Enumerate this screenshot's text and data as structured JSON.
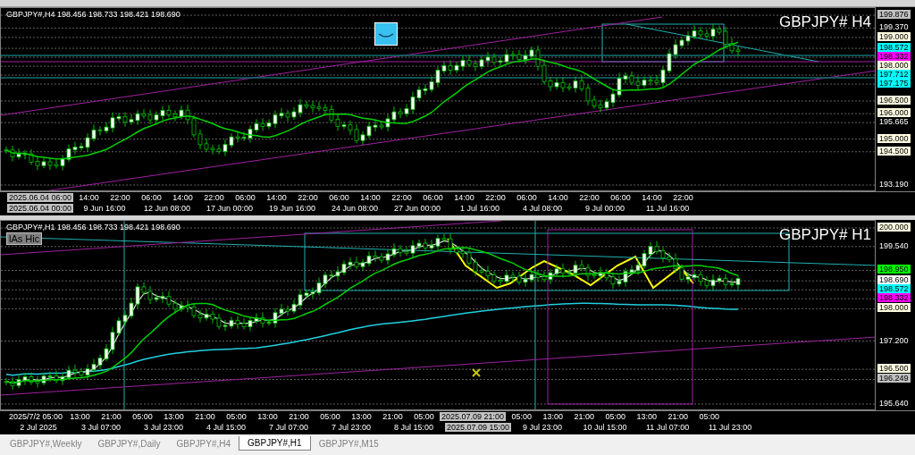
{
  "panels": [
    {
      "header": "GBPJPY#,H4 198.456 198.733 198.421 198.690",
      "title": "GBPJPY#  H4",
      "marker_button": true,
      "price_labels": [
        {
          "text": "199.876",
          "kind": "tag",
          "color": "#c0c0c0"
        },
        {
          "text": "199.370",
          "kind": "plain"
        },
        {
          "text": "199.000",
          "kind": "tag",
          "color": "#fffbe0"
        },
        {
          "text": "198.572",
          "kind": "tag",
          "color": "#00ffff"
        },
        {
          "text": "198.332",
          "kind": "tag",
          "color": "#ff00ff"
        },
        {
          "text": "198.000",
          "kind": "tag",
          "color": "#fffbe0"
        },
        {
          "text": "197.712",
          "kind": "tag",
          "color": "#00ffff"
        },
        {
          "text": "197.175",
          "kind": "tag",
          "color": "#00ffff"
        },
        {
          "text": "196.500",
          "kind": "tag",
          "color": "#fffbe0"
        },
        {
          "text": "196.000",
          "kind": "tag",
          "color": "#fffbe0"
        },
        {
          "text": "195.665",
          "kind": "plain"
        },
        {
          "text": "195.000",
          "kind": "tag",
          "color": "#fffbe0"
        },
        {
          "text": "194.500",
          "kind": "tag",
          "color": "#fffbe0"
        },
        {
          "text": "193.190",
          "kind": "plain"
        }
      ],
      "time_top": [
        {
          "text": "2025.06.04 06:00",
          "kind": "cursor"
        },
        {
          "text": "14:00",
          "kind": "tick"
        },
        {
          "text": "22:00",
          "kind": "tick"
        },
        {
          "text": "06:00",
          "kind": "tick"
        },
        {
          "text": "14:00",
          "kind": "tick"
        },
        {
          "text": "22:00",
          "kind": "tick"
        },
        {
          "text": "06:00",
          "kind": "tick"
        },
        {
          "text": "14:00",
          "kind": "tick"
        },
        {
          "text": "22:00",
          "kind": "tick"
        },
        {
          "text": "06:00",
          "kind": "tick"
        },
        {
          "text": "14:00",
          "kind": "tick"
        },
        {
          "text": "22:00",
          "kind": "tick"
        },
        {
          "text": "06:00",
          "kind": "tick"
        },
        {
          "text": "14:00",
          "kind": "tick"
        },
        {
          "text": "22:00",
          "kind": "tick"
        },
        {
          "text": "06:00",
          "kind": "tick"
        },
        {
          "text": "14:00",
          "kind": "tick"
        },
        {
          "text": "22:00",
          "kind": "tick"
        },
        {
          "text": "06:00",
          "kind": "tick"
        },
        {
          "text": "14:00",
          "kind": "tick"
        },
        {
          "text": "22:00",
          "kind": "tick"
        }
      ],
      "time_bottom": [
        {
          "text": "2025.06.04 00:00",
          "kind": "cursor"
        },
        {
          "text": "9 Jun 16:00",
          "kind": "tick"
        },
        {
          "text": "12 Jun 08:00",
          "kind": "tick"
        },
        {
          "text": "17 Jun 00:00",
          "kind": "tick"
        },
        {
          "text": "19 Jun 16:00",
          "kind": "tick"
        },
        {
          "text": "24 Jun 08:00",
          "kind": "tick"
        },
        {
          "text": "27 Jun 00:00",
          "kind": "tick"
        },
        {
          "text": "1 Jul 16:00",
          "kind": "tick"
        },
        {
          "text": "4 Jul 08:00",
          "kind": "tick"
        },
        {
          "text": "9 Jul 00:00",
          "kind": "tick"
        },
        {
          "text": "11 Jul 16:00",
          "kind": "tick"
        }
      ]
    },
    {
      "header": "GBPJPY#,H1 198.456 198.733 198.421 198.690",
      "title": "GBPJPY#  H1",
      "button_label": "lAs Hic",
      "price_labels": [
        {
          "text": "200.000",
          "kind": "tag",
          "color": "#fffbe0"
        },
        {
          "text": "199.540",
          "kind": "plain"
        },
        {
          "text": "198.950",
          "kind": "tag",
          "color": "#00ff00"
        },
        {
          "text": "198.690",
          "kind": "tag",
          "color": "#ffffff"
        },
        {
          "text": "198.572",
          "kind": "tag",
          "color": "#00ffff"
        },
        {
          "text": "198.332",
          "kind": "tag",
          "color": "#ff00ff"
        },
        {
          "text": "198.000",
          "kind": "tag",
          "color": "#fffbe0"
        },
        {
          "text": "197.200",
          "kind": "plain"
        },
        {
          "text": "196.500",
          "kind": "tag",
          "color": "#fffbe0"
        },
        {
          "text": "196.249",
          "kind": "tag",
          "color": "#c0c0c0"
        },
        {
          "text": "195.640",
          "kind": "plain"
        }
      ],
      "time_top": [
        {
          "text": "2025/7/2 05:00",
          "kind": "tick"
        },
        {
          "text": "13:00",
          "kind": "tick"
        },
        {
          "text": "21:00",
          "kind": "tick"
        },
        {
          "text": "05:00",
          "kind": "tick"
        },
        {
          "text": "13:00",
          "kind": "tick"
        },
        {
          "text": "21:00",
          "kind": "tick"
        },
        {
          "text": "05:00",
          "kind": "tick"
        },
        {
          "text": "13:00",
          "kind": "tick"
        },
        {
          "text": "21:00",
          "kind": "tick"
        },
        {
          "text": "05:00",
          "kind": "tick"
        },
        {
          "text": "13:00",
          "kind": "tick"
        },
        {
          "text": "21:00",
          "kind": "tick"
        },
        {
          "text": "05:00",
          "kind": "tick"
        },
        {
          "text": "2025.07.09 21:00",
          "kind": "cursor"
        },
        {
          "text": "05:00",
          "kind": "tick"
        },
        {
          "text": "13:00",
          "kind": "tick"
        },
        {
          "text": "21:00",
          "kind": "tick"
        },
        {
          "text": "05:00",
          "kind": "tick"
        },
        {
          "text": "13:00",
          "kind": "tick"
        },
        {
          "text": "21:00",
          "kind": "tick"
        },
        {
          "text": "05:00",
          "kind": "tick"
        }
      ],
      "time_bottom": [
        {
          "text": "2 Jul 2025",
          "kind": "tick"
        },
        {
          "text": "3 Jul 07:00",
          "kind": "tick"
        },
        {
          "text": "3 Jul 23:00",
          "kind": "tick"
        },
        {
          "text": "4 Jul 15:00",
          "kind": "tick"
        },
        {
          "text": "7 Jul 07:00",
          "kind": "tick"
        },
        {
          "text": "7 Jul 23:00",
          "kind": "tick"
        },
        {
          "text": "8 Jul 15:00",
          "kind": "tick"
        },
        {
          "text": "2025.07.09 15:00",
          "kind": "cursor"
        },
        {
          "text": "9 Jul 23:00",
          "kind": "tick"
        },
        {
          "text": "10 Jul 15:00",
          "kind": "tick"
        },
        {
          "text": "11 Jul 07:00",
          "kind": "tick"
        },
        {
          "text": "11 Jul 23:00",
          "kind": "tick"
        }
      ]
    }
  ],
  "tabs": [
    {
      "label": "GBPJPY#,Weekly",
      "selected": false
    },
    {
      "label": "GBPJPY#,Daily",
      "selected": false
    },
    {
      "label": "GBPJPY#,H4",
      "selected": false
    },
    {
      "label": "GBPJPY#,H1",
      "selected": true
    },
    {
      "label": "GBPJPY#,M15",
      "selected": false
    }
  ]
}
